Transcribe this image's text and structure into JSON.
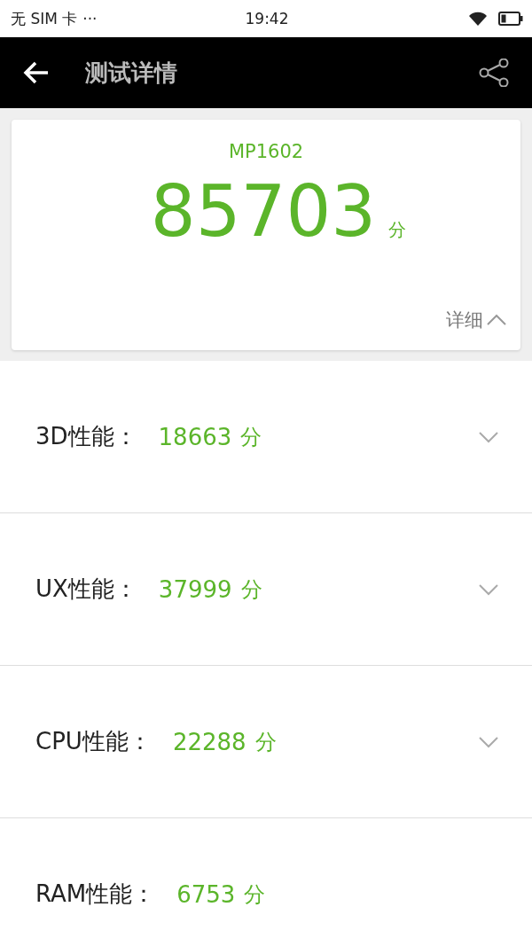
{
  "status_bar": {
    "carrier": "无 SIM 卡",
    "more": "···",
    "time": "19:42"
  },
  "app_bar": {
    "title": "测试详情"
  },
  "summary": {
    "device": "MP1602",
    "score": "85703",
    "unit": "分",
    "details_label": "详细",
    "expanded": true
  },
  "results": [
    {
      "kind": "expandable",
      "label": "3D性能：",
      "score": "18663",
      "unit": "分",
      "expanded": false
    },
    {
      "kind": "expandable",
      "label": "UX性能：",
      "score": "37999",
      "unit": "分",
      "expanded": false
    },
    {
      "kind": "expandable",
      "label": "CPU性能：",
      "score": "22288",
      "unit": "分",
      "expanded": false
    },
    {
      "kind": "plain",
      "label": "RAM性能：",
      "score": "6753",
      "unit": "分"
    }
  ]
}
